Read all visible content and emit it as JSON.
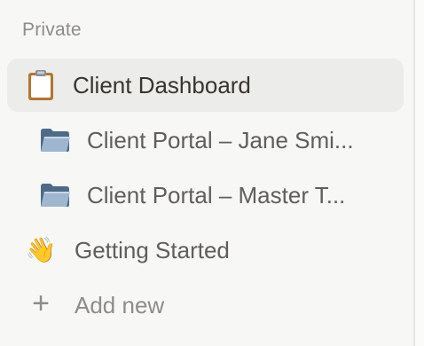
{
  "sidebar": {
    "section_label": "Private",
    "items": [
      {
        "label": "Client Dashboard",
        "icon": "clipboard-icon",
        "active": true
      },
      {
        "label": "Client Portal – Jane Smi...",
        "icon": "folder-icon",
        "level": 1
      },
      {
        "label": "Client Portal – Master T...",
        "icon": "folder-icon",
        "level": 1
      },
      {
        "label": "Getting Started",
        "icon": "waving-hand-icon",
        "icon_glyph": "👋"
      },
      {
        "label": "Add new",
        "icon": "plus-icon",
        "icon_glyph": "+"
      }
    ]
  },
  "colors": {
    "background": "#f7f7f5",
    "active_row": "#ececea",
    "primary_text": "#37352f",
    "secondary_text": "#5f5e5b",
    "muted_text": "#8d8c88"
  }
}
